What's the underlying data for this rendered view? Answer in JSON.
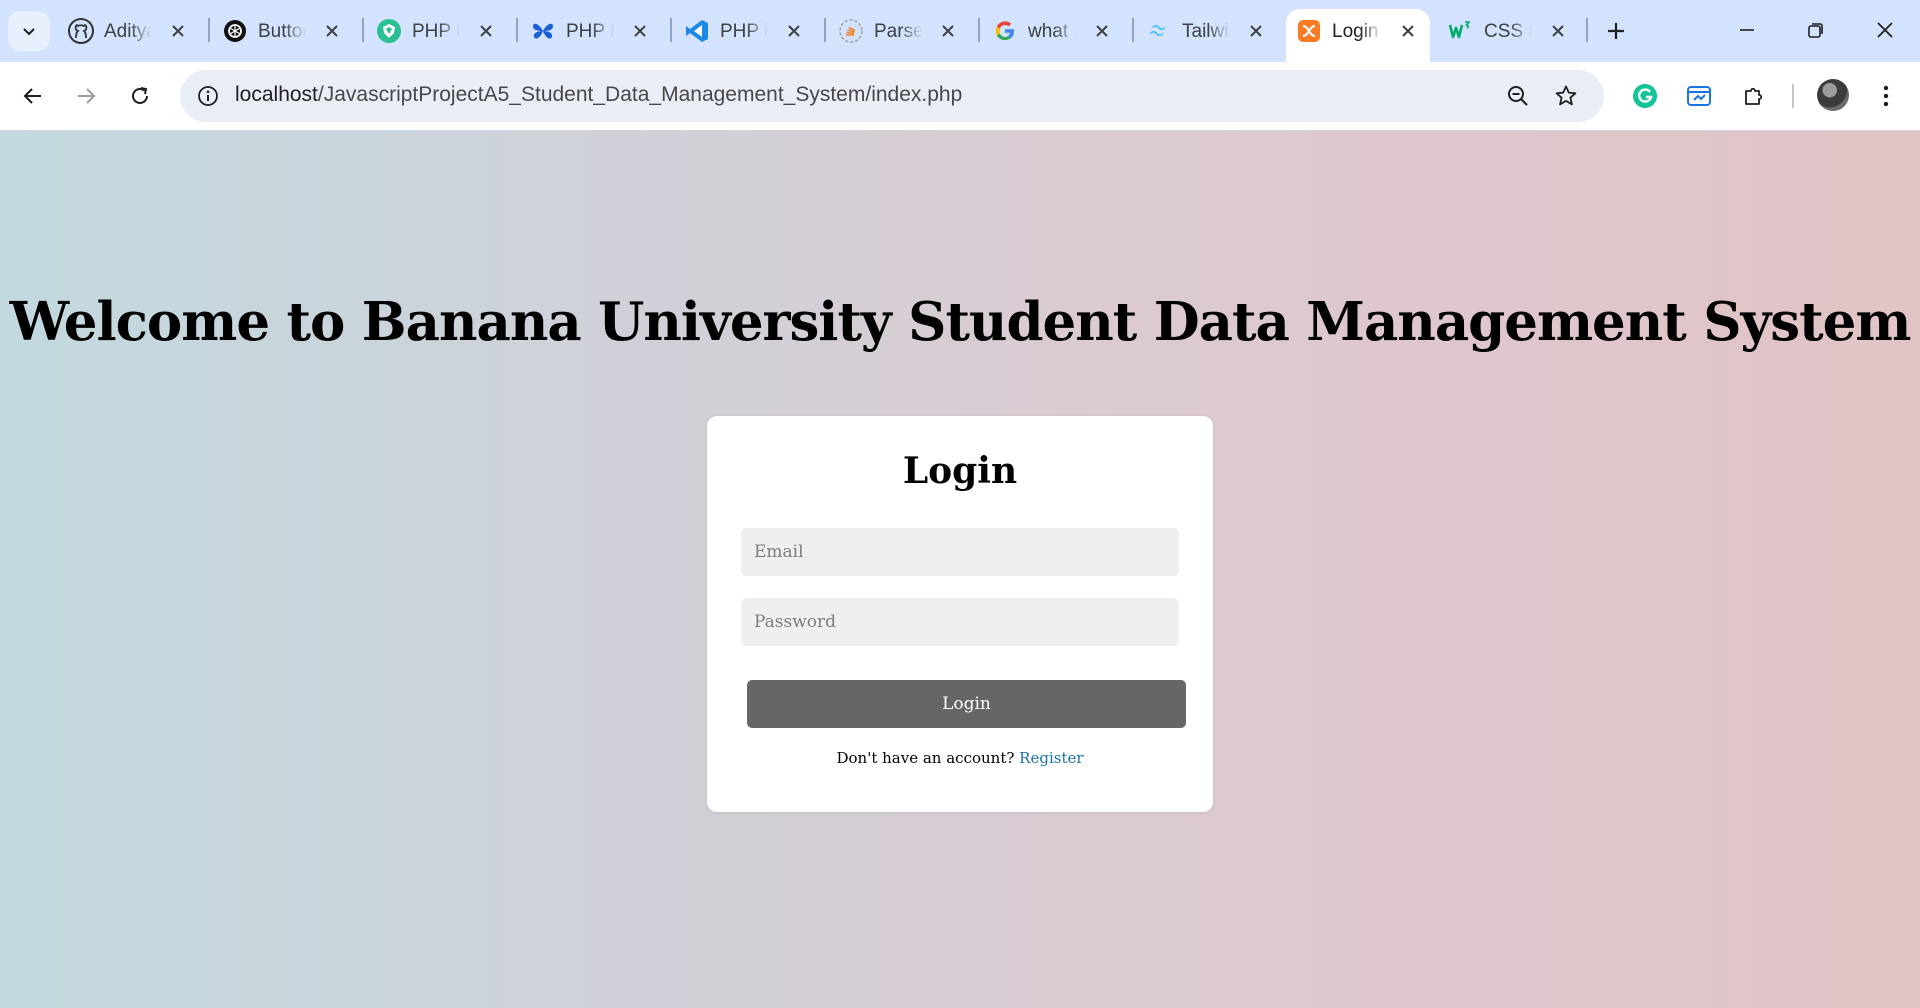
{
  "browser": {
    "tabs": [
      {
        "title": "Aditya",
        "icon": "github-icon",
        "active": false
      },
      {
        "title": "Button",
        "icon": "openai-icon",
        "active": false
      },
      {
        "title": "PHP M",
        "icon": "shield-icon",
        "active": false
      },
      {
        "title": "PHP P",
        "icon": "butterfly-icon",
        "active": false
      },
      {
        "title": "PHP in",
        "icon": "vscode-icon",
        "active": false
      },
      {
        "title": "Parse",
        "icon": "stackoverflow-icon",
        "active": false
      },
      {
        "title": "what t",
        "icon": "google-icon",
        "active": false
      },
      {
        "title": "Tailwi",
        "icon": "tailwind-icon",
        "active": false
      },
      {
        "title": "Login",
        "icon": "xampp-icon",
        "active": true
      },
      {
        "title": "CSS S",
        "icon": "w3schools-icon",
        "active": false
      }
    ],
    "url_host": "localhost",
    "url_path": "/JavascriptProjectA5_Student_Data_Management_System/index.php",
    "colors": {
      "tabstrip": "#d3e3fd",
      "omnibox": "#e9eef6"
    }
  },
  "page": {
    "welcome_heading": "Welcome to Banana University Student Data Management System",
    "login": {
      "heading": "Login",
      "email_placeholder": "Email",
      "password_placeholder": "Password",
      "submit_label": "Login",
      "no_account_text": "Don't have an account?",
      "register_label": "Register"
    },
    "colors": {
      "button": "#666666",
      "link": "#1a73a8"
    }
  }
}
